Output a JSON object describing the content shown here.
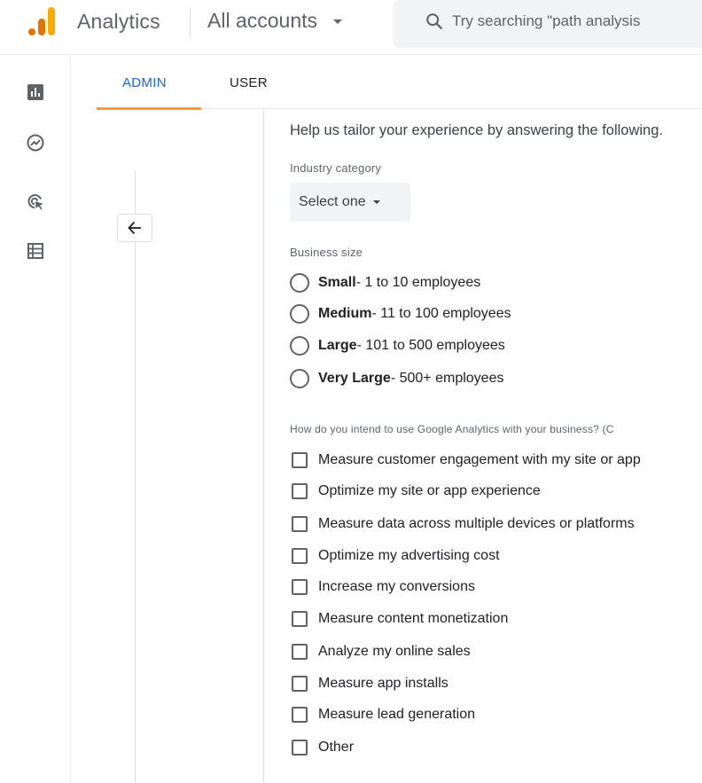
{
  "header": {
    "app_name": "Analytics",
    "account_picker": "All accounts",
    "search_placeholder": "Try searching \"path analysis"
  },
  "rail": {
    "items": [
      "reports-icon",
      "explore-icon",
      "advertising-icon",
      "configure-icon"
    ]
  },
  "tabs": [
    {
      "label": "ADMIN",
      "active": true
    },
    {
      "label": "USER",
      "active": false
    }
  ],
  "form": {
    "intro": "Help us tailor your experience by answering the following.",
    "industry_label": "Industry category",
    "industry_select": "Select one",
    "business_size_label": "Business size",
    "business_sizes": [
      {
        "name": "Small",
        "detail": " - 1 to 10 employees"
      },
      {
        "name": "Medium",
        "detail": " - 11 to 100 employees"
      },
      {
        "name": "Large",
        "detail": " - 101 to 500 employees"
      },
      {
        "name": "Very Large",
        "detail": " - 500+ employees"
      }
    ],
    "usage_label": "How do you intend to use Google Analytics with your business? (C",
    "usage_options": [
      "Measure customer engagement with my site or app",
      "Optimize my site or app experience",
      "Measure data across multiple devices or platforms",
      "Optimize my advertising cost",
      "Increase my conversions",
      "Measure content monetization",
      "Analyze my online sales",
      "Measure app installs",
      "Measure lead generation",
      "Other"
    ]
  },
  "colors": {
    "accent_tab": "#1967d2",
    "tab_indicator": "#e8a33b",
    "logo_orange": "#f9ab00",
    "logo_dark_orange": "#e37400"
  }
}
